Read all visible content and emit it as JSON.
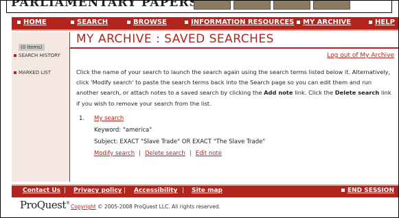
{
  "banner": {
    "title": "PARLIAMENTARY PAPERS"
  },
  "nav": {
    "items": [
      {
        "label": "HOME"
      },
      {
        "label": "SEARCH"
      },
      {
        "label": "BROWSE"
      },
      {
        "label": "INFORMATION RESOURCES"
      },
      {
        "label": "MY ARCHIVE"
      },
      {
        "label": "HELP"
      }
    ]
  },
  "sidebar": {
    "search_history": "SEARCH HISTORY",
    "marked_list": "MARKED LIST",
    "marked_count": "(0 items)"
  },
  "main": {
    "title": "MY ARCHIVE : SAVED SEARCHES",
    "logout": "Log out of My Archive",
    "instructions": {
      "p1": "Click the name of your search to launch the search again using the search terms listed below it. Alternatively, click 'Modify search' to paste the search terms back into the Search page so you can edit them and run another search, or attach notes to a saved search by clicking the ",
      "add_note": "Add note",
      "p2": " link. Click the ",
      "delete_search": "Delete search",
      "p3": " link if you wish to remove your search from the list."
    },
    "saved": [
      {
        "number": "1.",
        "name": "My search",
        "keyword": "Keyword: \"america\"",
        "subject": "Subject: EXACT \"Slave Trade\" OR EXACT \"The Slave Trade\"",
        "modify": "Modify search",
        "delete": "Delete search",
        "edit_note": "Edit note",
        "separator": "|"
      }
    ]
  },
  "footer": {
    "links": [
      {
        "label": "Contact Us"
      },
      {
        "label": "Privacy policy"
      },
      {
        "label": "Accessibility"
      },
      {
        "label": "Site map"
      }
    ],
    "separator": "|",
    "end_session": "END SESSION"
  },
  "bottom": {
    "logo": "ProQuest",
    "copyright_link": "Copyright",
    "copyright_text": " © 2005-2008 ProQuest LLC. All rights reserved."
  },
  "colors": {
    "accent": "#b3241c",
    "sidebar_bg": "#f5e7e2"
  }
}
